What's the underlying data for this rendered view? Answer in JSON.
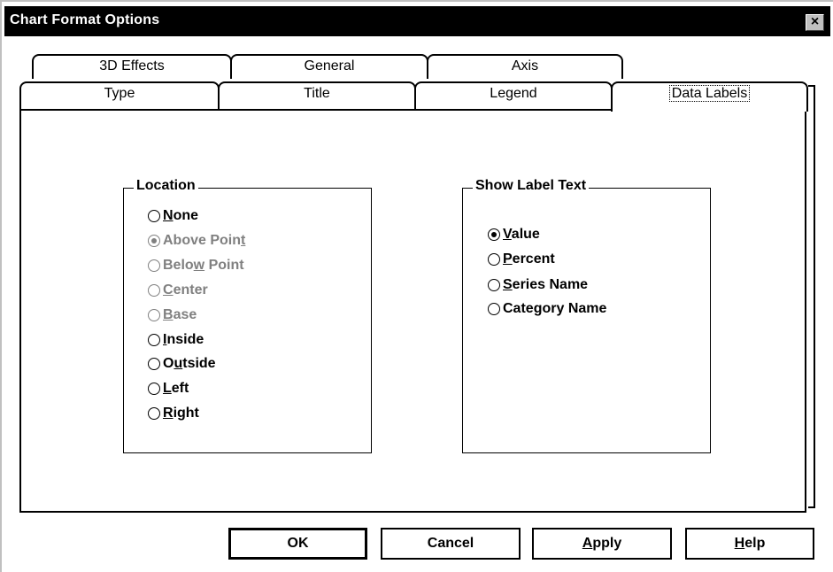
{
  "window": {
    "title": "Chart Format Options",
    "close_glyph": "×"
  },
  "tabs_back_row": [
    {
      "label": "3D Effects"
    },
    {
      "label": "General"
    },
    {
      "label": "Axis"
    }
  ],
  "tabs_front_row": [
    {
      "label": "Type"
    },
    {
      "label": "Title"
    },
    {
      "label": "Legend"
    },
    {
      "label": "Data Labels",
      "active": true
    }
  ],
  "location_group": {
    "legend": "Location",
    "options": [
      {
        "pre": "",
        "key": "N",
        "post": "one",
        "checked": false,
        "disabled": false
      },
      {
        "pre": "Above Poin",
        "key": "t",
        "post": "",
        "checked": true,
        "disabled": true
      },
      {
        "pre": "Belo",
        "key": "w",
        "post": " Point",
        "checked": false,
        "disabled": true
      },
      {
        "pre": "",
        "key": "C",
        "post": "enter",
        "checked": false,
        "disabled": true
      },
      {
        "pre": "",
        "key": "B",
        "post": "ase",
        "checked": false,
        "disabled": true
      },
      {
        "pre": "",
        "key": "I",
        "post": "nside",
        "checked": false,
        "disabled": false
      },
      {
        "pre": "O",
        "key": "u",
        "post": "tside",
        "checked": false,
        "disabled": false
      },
      {
        "pre": "",
        "key": "L",
        "post": "eft",
        "checked": false,
        "disabled": false
      },
      {
        "pre": "",
        "key": "R",
        "post": "ight",
        "checked": false,
        "disabled": false
      }
    ]
  },
  "label_text_group": {
    "legend": "Show Label Text",
    "options": [
      {
        "pre": "",
        "key": "V",
        "post": "alue",
        "checked": true,
        "disabled": false
      },
      {
        "pre": "",
        "key": "P",
        "post": "ercent",
        "checked": false,
        "disabled": false
      },
      {
        "pre": "",
        "key": "S",
        "post": "eries Name",
        "checked": false,
        "disabled": false
      },
      {
        "pre": "Cate",
        "key": "g",
        "post": "ory Name",
        "checked": false,
        "disabled": false
      }
    ]
  },
  "buttons": {
    "ok": {
      "label": "OK"
    },
    "cancel": {
      "label": "Cancel"
    },
    "apply": {
      "pre": "",
      "key": "A",
      "post": "pply"
    },
    "help": {
      "pre": "",
      "key": "H",
      "post": "elp"
    }
  }
}
